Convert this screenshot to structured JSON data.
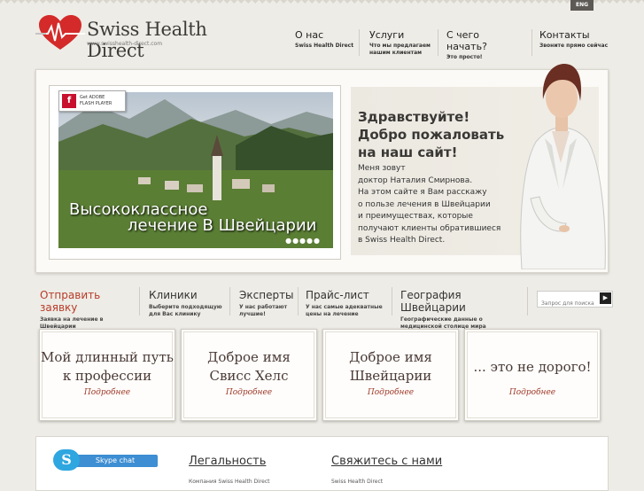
{
  "language": "ENG",
  "logo": {
    "title": "Swiss Health Direct",
    "url": "www.swisshealth-direct.com"
  },
  "topnav": [
    {
      "label": "О нас",
      "sub": "Swiss Health Direct"
    },
    {
      "label": "Услуги",
      "sub": "Что мы предлагаем нашим клиентам"
    },
    {
      "label": "С чего начать?",
      "sub": "Это просто!"
    },
    {
      "label": "Контакты",
      "sub": "Звоните прямо сейчас"
    }
  ],
  "flash": {
    "line1": "Get ADOBE",
    "line2": "FLASH PLAYER"
  },
  "photo": {
    "caption1": "Высококлассное",
    "caption2": "лечение В Швейцарии",
    "dots": "●●●●●"
  },
  "welcome": {
    "title_line1": "Здравствуйте!",
    "title_line2": "Добро пожаловать",
    "title_line3": "на наш сайт!",
    "text_lines": [
      "Меня зовут",
      "доктор Наталия Смирнова.",
      "На этом сайте я Вам расскажу",
      "о пользе лечения в Швейцарии",
      "и преимуществах, которые",
      "получают клиенты обратившиеся",
      "в Swiss Health Direct."
    ]
  },
  "subnav": [
    {
      "label": "Отправить заявку",
      "sub": "Заявка на лечение в Швейцарии"
    },
    {
      "label": "Клиники",
      "sub": "Выберите подходящую для Вас клинику"
    },
    {
      "label": "Эксперты",
      "sub": "У нас работают лучшие!"
    },
    {
      "label": "Прайс-лист",
      "sub": "У нас самые адекватные цены на лечение"
    },
    {
      "label": "География Швейцарии",
      "sub": "Географические данные о медицинской столице мира"
    }
  ],
  "search": {
    "placeholder": "Запрос для поиска"
  },
  "cards": [
    {
      "line1": "Мой длинный путь",
      "line2": "к профессии",
      "more": "Подробнее"
    },
    {
      "line1": "Доброе имя",
      "line2": "Свисс Хелс",
      "more": "Подробнее"
    },
    {
      "line1": "Доброе имя",
      "line2": "Швейцарии",
      "more": "Подробнее"
    },
    {
      "line1": "... это не дорого!",
      "line2": "",
      "more": "Подробнее"
    }
  ],
  "bottom": {
    "skype": "Skype chat",
    "link1": "Легальность",
    "link2": "Свяжитесь с нами",
    "small1": "Компания Swiss Health Direct",
    "small2": "Swiss Health Direct"
  }
}
